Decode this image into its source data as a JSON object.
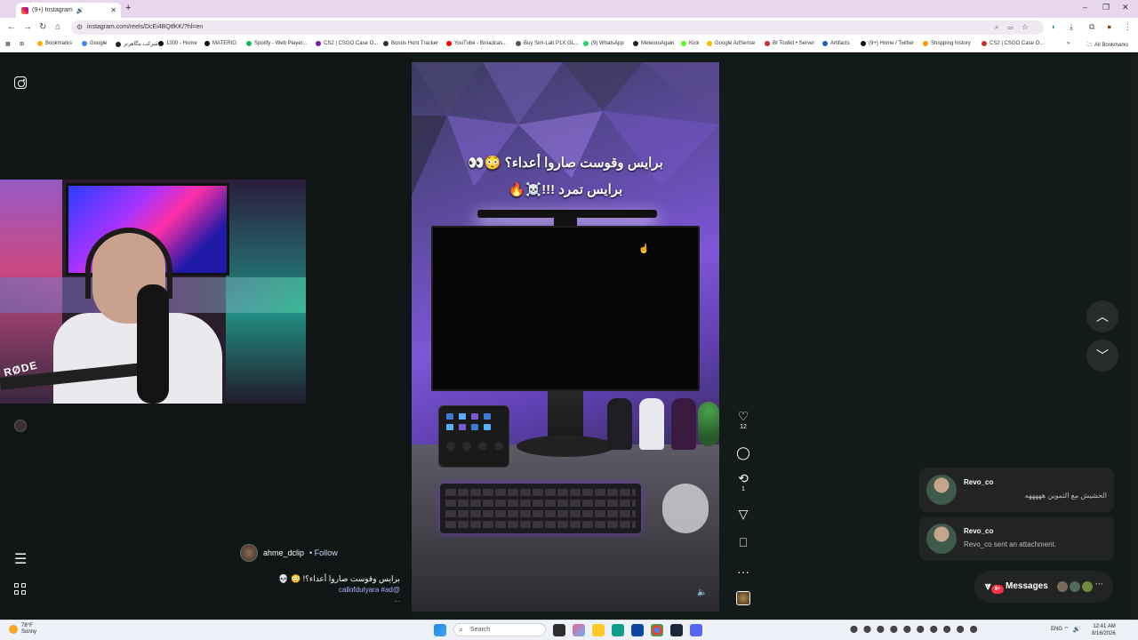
{
  "browser": {
    "tab_title": "(9+) Instagram",
    "tab_audio_icon": "speaker-icon",
    "new_tab": "+",
    "url": "instagram.com/reels/DcEi4BQtfKK/?hl=en",
    "window_controls": [
      "–",
      "❐",
      "✕"
    ],
    "bookmarks": [
      {
        "label": "Bookmarks",
        "color": "#f4b400"
      },
      {
        "label": "Google",
        "color": "#4285f4"
      },
      {
        "label": "شرکت مگاهرتز",
        "color": "#222222"
      },
      {
        "label": "1000 - Home",
        "color": "#111111"
      },
      {
        "label": "MATERIO",
        "color": "#111111"
      },
      {
        "label": "Spotify - Web Player...",
        "color": "#1db954"
      },
      {
        "label": "CS2 | CSGO Case O...",
        "color": "#7b1fa2"
      },
      {
        "label": "Bonus Hunt Tracker",
        "color": "#333333"
      },
      {
        "label": "YouTube - Broadcas...",
        "color": "#ff0000"
      },
      {
        "label": "Buy Sim-Lab P1X GL...",
        "color": "#555555"
      },
      {
        "label": "(9) WhatsApp",
        "color": "#25d366"
      },
      {
        "label": "MeteoroAgain",
        "color": "#222222"
      },
      {
        "label": "Kick",
        "color": "#53fc18"
      },
      {
        "label": "Google AdSense",
        "color": "#fbbc05"
      },
      {
        "label": "BI Toolkit • Server",
        "color": "#d32f2f"
      },
      {
        "label": "Artifacts",
        "color": "#1565c0"
      },
      {
        "label": "(9+) Home / Twitter",
        "color": "#111111"
      },
      {
        "label": "Shopping history",
        "color": "#ff9800"
      },
      {
        "label": "CS2 | CSGO Case O...",
        "color": "#d32f2f"
      }
    ],
    "all_bookmarks": "All Bookmarks"
  },
  "reel": {
    "title_line1": "برايس وقوست صاروا أعداء؟ 😳👀",
    "title_line2": "برايس تمرد !!!☠️🔥",
    "username": "ahme_dclip",
    "follow_label": "• Follow",
    "caption": "برايس وقوست صاروا أعداء؟! 😳 💀",
    "tags": "callofdutyara #ad@",
    "more": "...",
    "volume_icon": "volume-icon"
  },
  "actions": {
    "like_count": "12",
    "repost_count": "1",
    "more": "···"
  },
  "notifications": [
    {
      "name": "Revo_co",
      "message": "الحشيش مع التموين هههههه",
      "rtl": true
    },
    {
      "name": "Revo_co",
      "message": "Revo_co sent an attachment.",
      "rtl": false
    }
  ],
  "messages": {
    "label": "Messages",
    "badge": "9+",
    "more": "···"
  },
  "taskbar": {
    "temp": "78°F",
    "condition": "Sunny",
    "search_placeholder": "Search",
    "lang": "ENG",
    "time": "12:41 AM",
    "date": "8/16/2026"
  }
}
